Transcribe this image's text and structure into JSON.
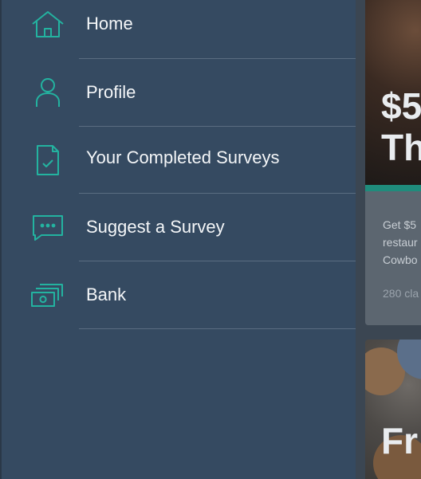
{
  "menu": {
    "items": [
      {
        "label": "Home",
        "icon": "home-icon"
      },
      {
        "label": "Profile",
        "icon": "profile-icon"
      },
      {
        "label": "Your Completed Surveys",
        "icon": "completed-surveys-icon"
      },
      {
        "label": "Suggest a Survey",
        "icon": "chat-bubble-icon"
      },
      {
        "label": "Bank",
        "icon": "bank-icon"
      }
    ]
  },
  "background_cards": {
    "card1": {
      "headline_1": "$5",
      "headline_2": "Th",
      "desc_line_1": "Get $5",
      "desc_line_2": "restaur",
      "desc_line_3": "Cowbo",
      "claims": "280 cla"
    },
    "card2": {
      "headline": "Fr"
    }
  },
  "colors": {
    "drawer_bg": "#354a61",
    "icon_accent": "#23b3a0",
    "card_accent": "#1f8c7c"
  }
}
